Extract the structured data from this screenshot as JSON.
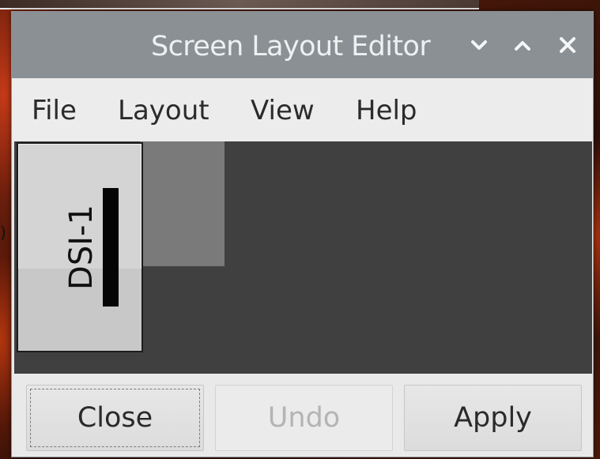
{
  "window": {
    "title": "Screen Layout Editor",
    "controls": {
      "menu_icon": "chevron-down-icon",
      "maximize_icon": "chevron-up-icon",
      "close_icon": "close-icon"
    }
  },
  "menubar": {
    "items": [
      {
        "label": "File"
      },
      {
        "label": "Layout"
      },
      {
        "label": "View"
      },
      {
        "label": "Help"
      }
    ]
  },
  "layout": {
    "monitor": {
      "label": "DSI-1"
    }
  },
  "buttons": {
    "close": {
      "label": "Close",
      "focused": true
    },
    "undo": {
      "label": "Undo",
      "enabled": false
    },
    "apply": {
      "label": "Apply"
    }
  },
  "background": {
    "edge_glyph": ")"
  },
  "colors": {
    "titlebar": "#8a9094",
    "canvas": "#404040",
    "monitor": "#d4d4d4",
    "window": "#e9e9e9"
  }
}
